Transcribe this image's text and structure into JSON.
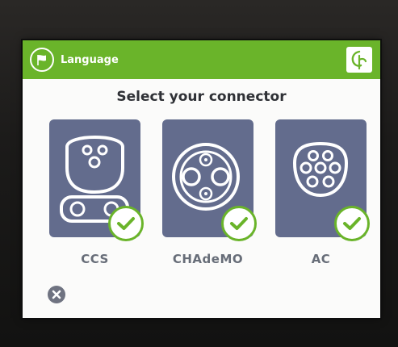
{
  "header": {
    "language_label": "Language",
    "language_icon": "flag-icon",
    "brand_icon": "leaf-logo-icon"
  },
  "main": {
    "title": "Select your connector",
    "connectors": [
      {
        "label": "CCS",
        "icon": "ccs-plug-icon",
        "selected": true
      },
      {
        "label": "CHAdeMO",
        "icon": "chademo-plug-icon",
        "selected": true
      },
      {
        "label": "AC",
        "icon": "type2-ac-plug-icon",
        "selected": true
      }
    ]
  },
  "footer": {
    "close_icon": "close-icon"
  },
  "colors": {
    "accent_green": "#6ab42a",
    "card_background": "#636c8d",
    "screen_background": "#fbfbfa",
    "label_gray": "#676d78"
  }
}
